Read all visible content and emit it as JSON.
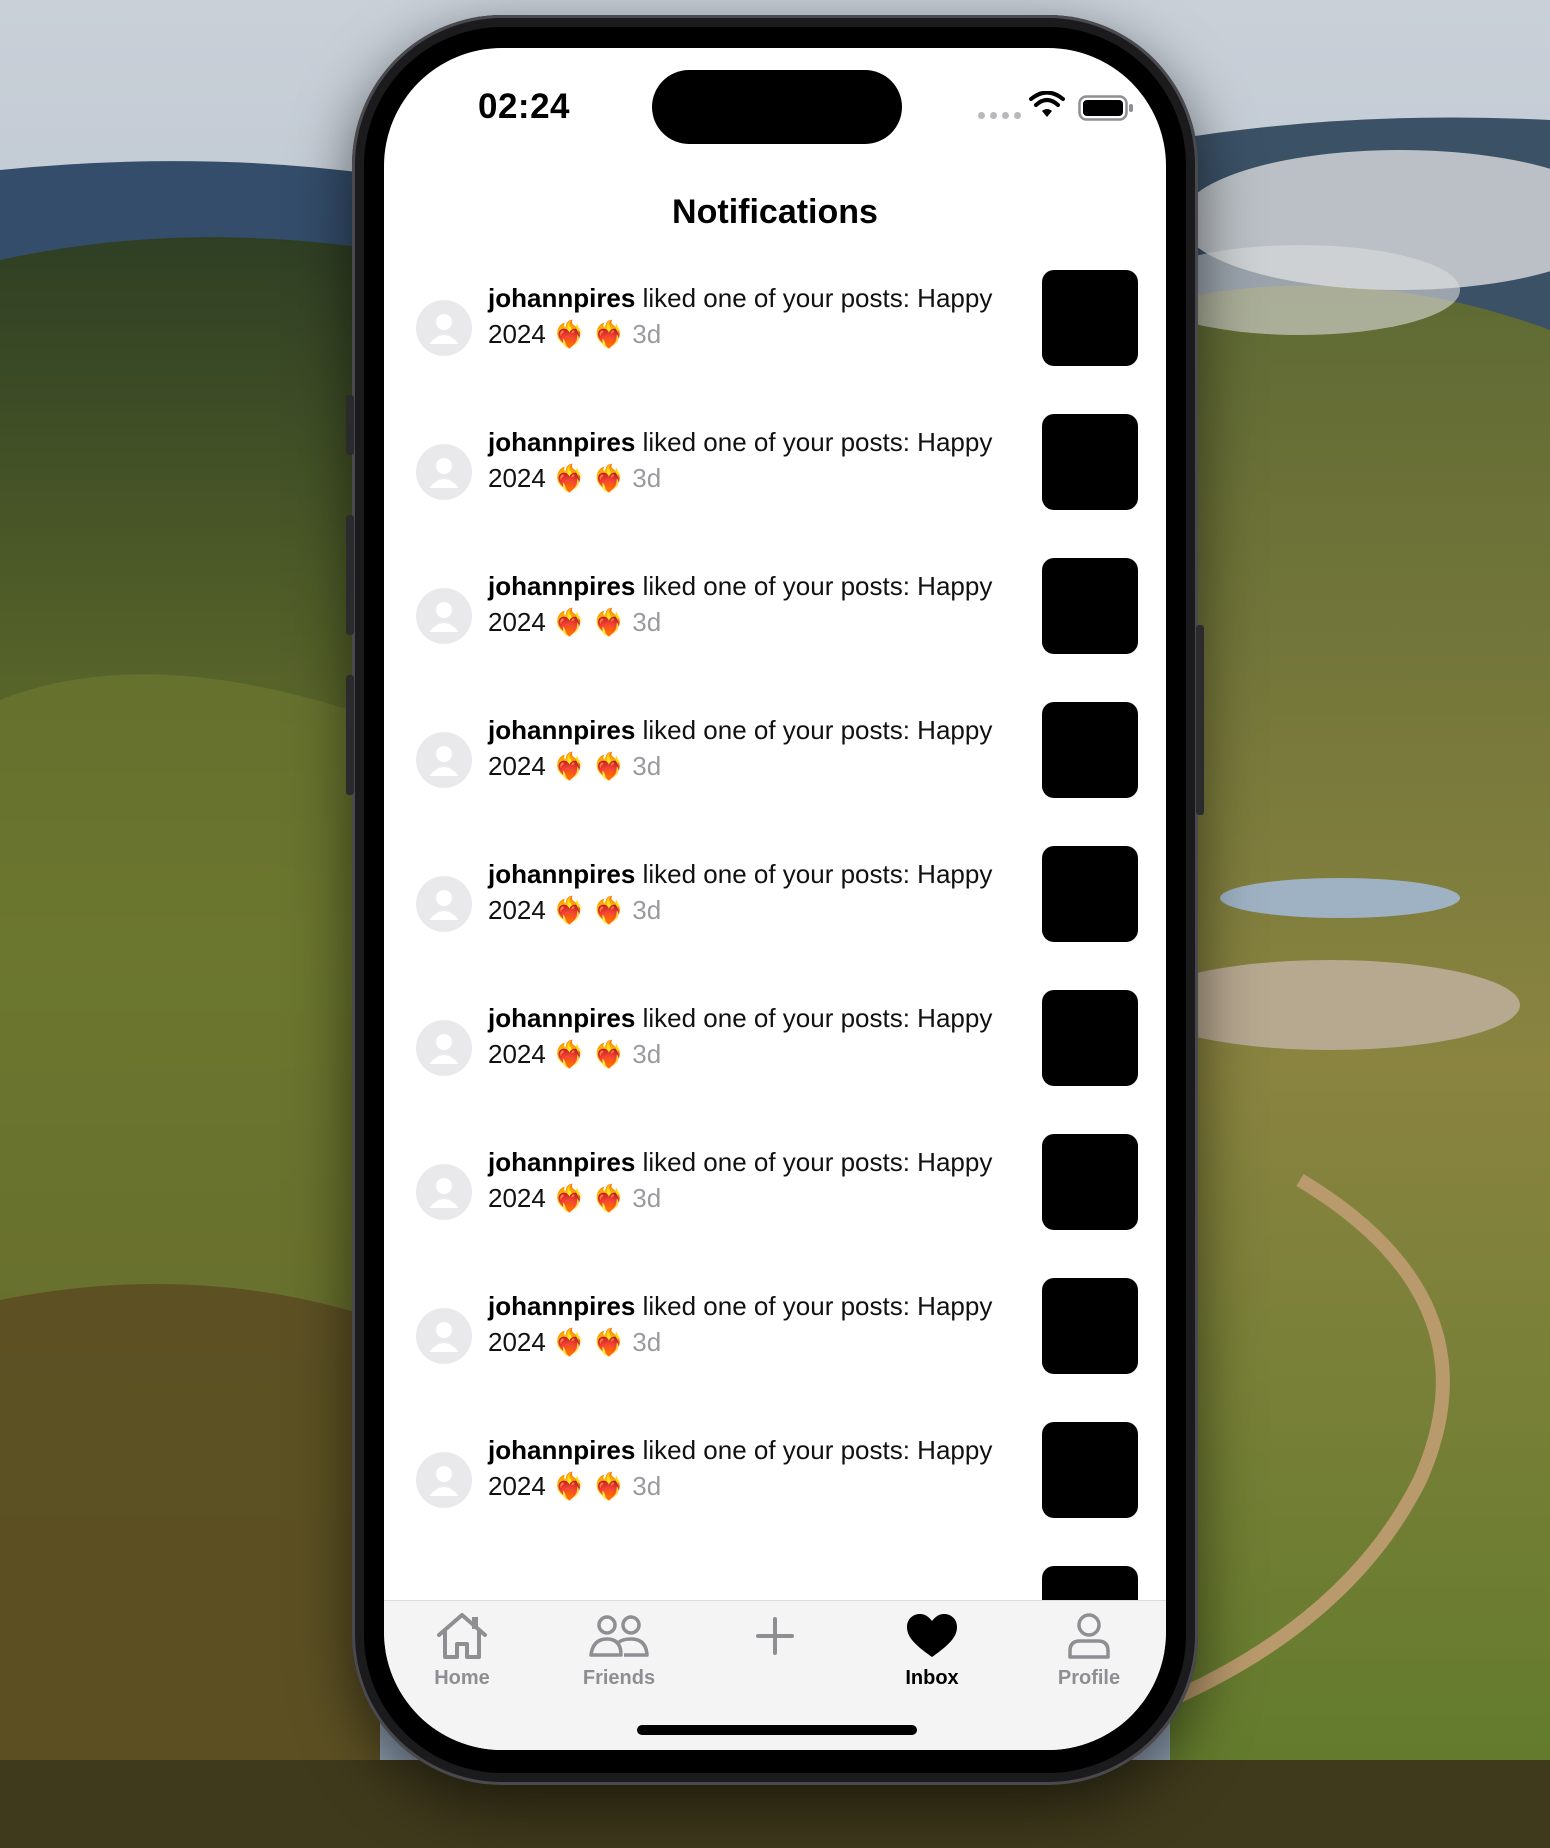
{
  "colors": {
    "thumbnail": "#000000",
    "active_tab": "#000000",
    "inactive_tab": "#8e8e93",
    "timestamp": "#9a9a9f",
    "avatar_bg": "#e9e9ec"
  },
  "status_bar": {
    "time": "02:24",
    "icons": [
      "signal-dots-icon",
      "wifi-icon",
      "battery-icon"
    ]
  },
  "header": {
    "title": "Notifications"
  },
  "notifications": [
    {
      "user": "johannpires",
      "text": " liked one of your posts: Happy 2024 ❤️‍🔥 ❤️‍🔥 ",
      "age": "3d"
    },
    {
      "user": "johannpires",
      "text": " liked one of your posts: Happy 2024 ❤️‍🔥 ❤️‍🔥 ",
      "age": "3d"
    },
    {
      "user": "johannpires",
      "text": " liked one of your posts: Happy 2024 ❤️‍🔥 ❤️‍🔥 ",
      "age": "3d"
    },
    {
      "user": "johannpires",
      "text": " liked one of your posts: Happy 2024 ❤️‍🔥 ❤️‍🔥 ",
      "age": "3d"
    },
    {
      "user": "johannpires",
      "text": " liked one of your posts: Happy 2024 ❤️‍🔥 ❤️‍🔥 ",
      "age": "3d"
    },
    {
      "user": "johannpires",
      "text": " liked one of your posts: Happy 2024 ❤️‍🔥 ❤️‍🔥 ",
      "age": "3d"
    },
    {
      "user": "johannpires",
      "text": " liked one of your posts: Happy 2024 ❤️‍🔥 ❤️‍🔥 ",
      "age": "3d"
    },
    {
      "user": "johannpires",
      "text": " liked one of your posts: Happy 2024 ❤️‍🔥 ❤️‍🔥 ",
      "age": "3d"
    },
    {
      "user": "johannpires",
      "text": " liked one of your posts: Happy 2024 ❤️‍🔥 ❤️‍🔥 ",
      "age": "3d"
    }
  ],
  "tabbar": {
    "tabs": [
      {
        "label": "Home",
        "icon": "home-icon",
        "active": false
      },
      {
        "label": "Friends",
        "icon": "friends-icon",
        "active": false
      },
      {
        "label": "",
        "icon": "plus-icon",
        "active": false
      },
      {
        "label": "Inbox",
        "icon": "heart-icon",
        "active": true
      },
      {
        "label": "Profile",
        "icon": "person-icon",
        "active": false
      }
    ]
  }
}
